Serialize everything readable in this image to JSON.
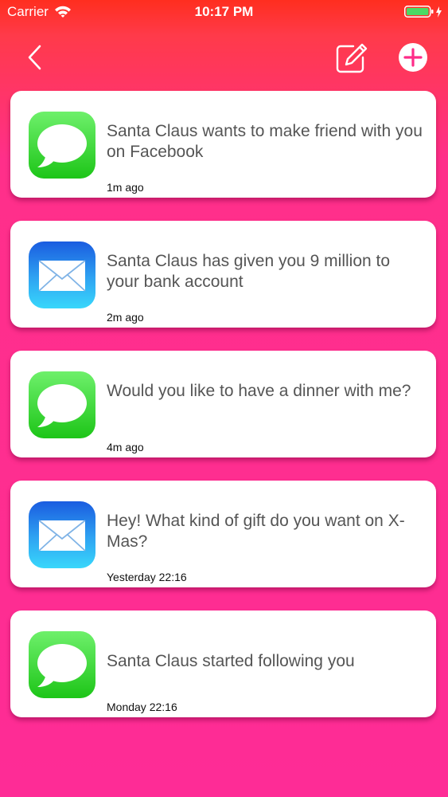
{
  "status_bar": {
    "carrier": "Carrier",
    "time": "10:17 PM"
  },
  "colors": {
    "background_top": "#ff2e1f",
    "background_bottom": "#fe2c96",
    "card": "#ffffff",
    "message_text": "#555555",
    "battery": "#4cd964"
  },
  "notifications": [
    {
      "icon": "messages-app-icon",
      "text": "Santa Claus wants to make friend with you on Facebook",
      "time": "1m ago"
    },
    {
      "icon": "mail-app-icon",
      "text": "Santa Claus has given you 9 million to your bank account",
      "time": "2m ago"
    },
    {
      "icon": "messages-app-icon",
      "text": "Would you like to have a dinner with me?",
      "time": "4m ago"
    },
    {
      "icon": "mail-app-icon",
      "text": "Hey! What kind of gift do you want on X-Mas?",
      "time": "Yesterday 22:16"
    },
    {
      "icon": "messages-app-icon",
      "text": "Santa Claus started following you",
      "time": "Monday 22:16"
    }
  ]
}
